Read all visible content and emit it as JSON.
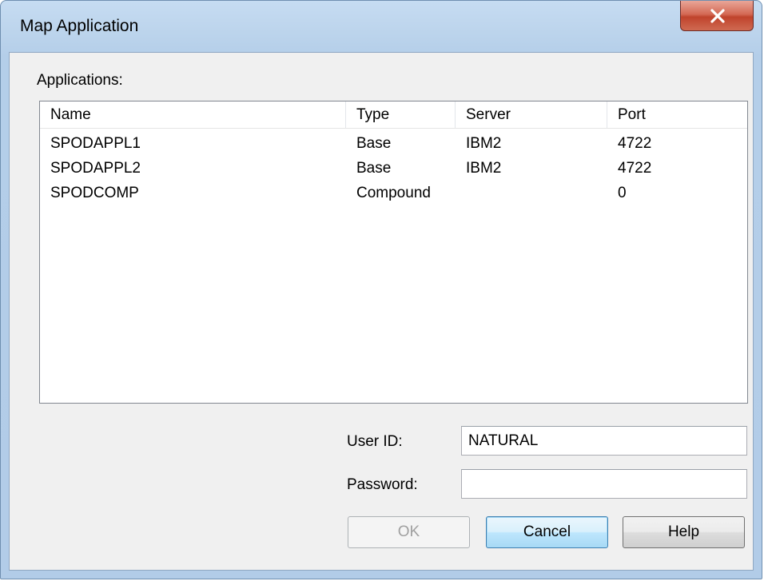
{
  "window": {
    "title": "Map Application"
  },
  "applications": {
    "label": "Applications:",
    "columns": [
      "Name",
      "Type",
      "Server",
      "Port"
    ],
    "rows": [
      {
        "name": "SPODAPPL1",
        "type": "Base",
        "server": "IBM2",
        "port": "4722"
      },
      {
        "name": "SPODAPPL2",
        "type": "Base",
        "server": "IBM2",
        "port": "4722"
      },
      {
        "name": "SPODCOMP",
        "type": "Compound",
        "server": "",
        "port": "0"
      }
    ]
  },
  "form": {
    "user_id_label": "User ID:",
    "user_id_value": "NATURAL",
    "password_label": "Password:",
    "password_value": ""
  },
  "buttons": {
    "ok": "OK",
    "cancel": "Cancel",
    "help": "Help"
  },
  "icons": {
    "close": "close-x-icon"
  },
  "colors": {
    "close_button": "#c7432c",
    "default_button_border": "#3c7fb1"
  }
}
